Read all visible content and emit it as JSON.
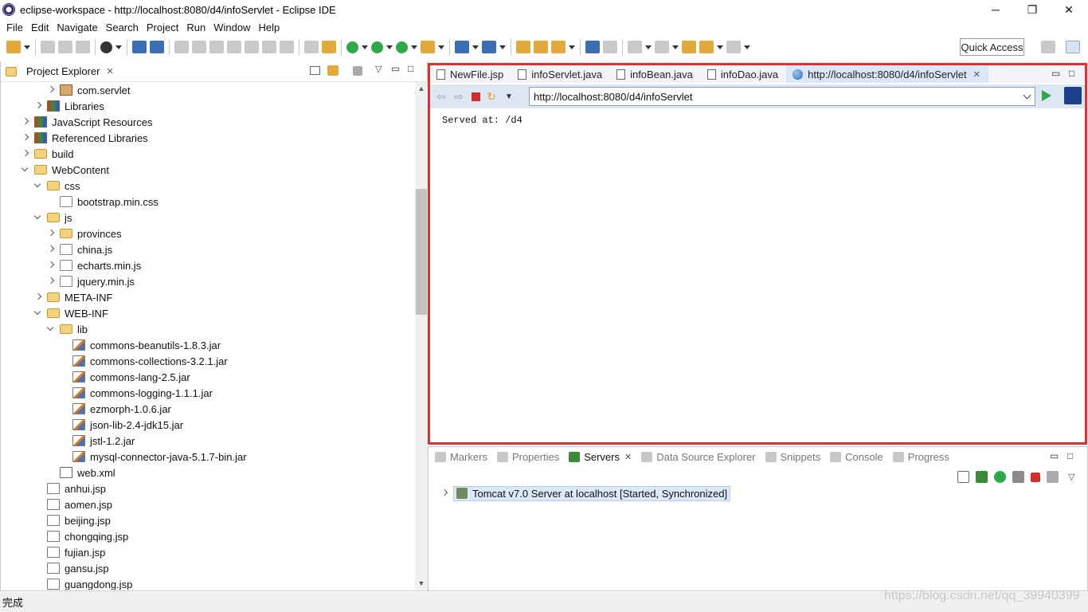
{
  "window": {
    "title": "eclipse-workspace - http://localhost:8080/d4/infoServlet - Eclipse IDE",
    "controls": {
      "minimize": "─",
      "maximize": "❐",
      "close": "✕"
    }
  },
  "menu": [
    "File",
    "Edit",
    "Navigate",
    "Search",
    "Project",
    "Run",
    "Window",
    "Help"
  ],
  "toolbar": {
    "quick_access": "Quick Access"
  },
  "project_explorer": {
    "title": "Project Explorer",
    "close": "✕",
    "items": [
      {
        "label": "com.servlet",
        "icon": "package-icon",
        "indent": 3,
        "twisty": "collapsed"
      },
      {
        "label": "Libraries",
        "icon": "library-icon",
        "indent": 2,
        "twisty": "collapsed"
      },
      {
        "label": "JavaScript Resources",
        "icon": "library-icon",
        "indent": 1,
        "twisty": "collapsed"
      },
      {
        "label": "Referenced Libraries",
        "icon": "library-icon",
        "indent": 1,
        "twisty": "collapsed"
      },
      {
        "label": "build",
        "icon": "folder-icon",
        "indent": 1,
        "twisty": "collapsed"
      },
      {
        "label": "WebContent",
        "icon": "folder-icon",
        "indent": 1,
        "twisty": "expanded"
      },
      {
        "label": "css",
        "icon": "folder-icon",
        "indent": 2,
        "twisty": "expanded"
      },
      {
        "label": "bootstrap.min.css",
        "icon": "css-file-icon",
        "indent": 3,
        "twisty": "none"
      },
      {
        "label": "js",
        "icon": "folder-icon",
        "indent": 2,
        "twisty": "expanded"
      },
      {
        "label": "provinces",
        "icon": "folder-icon",
        "indent": 3,
        "twisty": "collapsed"
      },
      {
        "label": "china.js",
        "icon": "js-file-icon",
        "indent": 3,
        "twisty": "collapsed"
      },
      {
        "label": "echarts.min.js",
        "icon": "js-file-icon",
        "indent": 3,
        "twisty": "collapsed"
      },
      {
        "label": "jquery.min.js",
        "icon": "js-file-icon",
        "indent": 3,
        "twisty": "collapsed"
      },
      {
        "label": "META-INF",
        "icon": "folder-icon",
        "indent": 2,
        "twisty": "collapsed"
      },
      {
        "label": "WEB-INF",
        "icon": "folder-icon",
        "indent": 2,
        "twisty": "expanded"
      },
      {
        "label": "lib",
        "icon": "folder-icon",
        "indent": 3,
        "twisty": "expanded"
      },
      {
        "label": "commons-beanutils-1.8.3.jar",
        "icon": "jar-icon",
        "indent": 4,
        "twisty": "none"
      },
      {
        "label": "commons-collections-3.2.1.jar",
        "icon": "jar-icon",
        "indent": 4,
        "twisty": "none"
      },
      {
        "label": "commons-lang-2.5.jar",
        "icon": "jar-icon",
        "indent": 4,
        "twisty": "none"
      },
      {
        "label": "commons-logging-1.1.1.jar",
        "icon": "jar-icon",
        "indent": 4,
        "twisty": "none"
      },
      {
        "label": "ezmorph-1.0.6.jar",
        "icon": "jar-icon",
        "indent": 4,
        "twisty": "none"
      },
      {
        "label": "json-lib-2.4-jdk15.jar",
        "icon": "jar-icon",
        "indent": 4,
        "twisty": "none"
      },
      {
        "label": "jstl-1.2.jar",
        "icon": "jar-icon",
        "indent": 4,
        "twisty": "none"
      },
      {
        "label": "mysql-connector-java-5.1.7-bin.jar",
        "icon": "jar-icon",
        "indent": 4,
        "twisty": "none"
      },
      {
        "label": "web.xml",
        "icon": "xml-file-icon",
        "indent": 3,
        "twisty": "none"
      },
      {
        "label": "anhui.jsp",
        "icon": "jsp-file-icon",
        "indent": 2,
        "twisty": "none"
      },
      {
        "label": "aomen.jsp",
        "icon": "jsp-file-icon",
        "indent": 2,
        "twisty": "none"
      },
      {
        "label": "beijing.jsp",
        "icon": "jsp-file-icon",
        "indent": 2,
        "twisty": "none"
      },
      {
        "label": "chongqing.jsp",
        "icon": "jsp-file-icon",
        "indent": 2,
        "twisty": "none"
      },
      {
        "label": "fujian.jsp",
        "icon": "jsp-file-icon",
        "indent": 2,
        "twisty": "none"
      },
      {
        "label": "gansu.jsp",
        "icon": "jsp-file-icon",
        "indent": 2,
        "twisty": "none"
      },
      {
        "label": "guangdong.jsp",
        "icon": "jsp-file-icon",
        "indent": 2,
        "twisty": "none"
      }
    ]
  },
  "editor": {
    "tabs": [
      {
        "label": "NewFile.jsp",
        "icon": "jsp-file-icon",
        "active": false
      },
      {
        "label": "infoServlet.java",
        "icon": "java-file-icon",
        "active": false
      },
      {
        "label": "infoBean.java",
        "icon": "java-file-icon",
        "active": false
      },
      {
        "label": "infoDao.java",
        "icon": "java-file-icon",
        "active": false
      },
      {
        "label": "http://localhost:8080/d4/infoServlet",
        "icon": "globe-icon",
        "active": true
      }
    ],
    "close_glyph": "✕",
    "url": "http://localhost:8080/d4/infoServlet",
    "content": "Served at: /d4",
    "highlight_color": "#e03131"
  },
  "bottom_panel": {
    "tabs": [
      {
        "label": "Markers",
        "active": false
      },
      {
        "label": "Properties",
        "active": false
      },
      {
        "label": "Servers",
        "active": true
      },
      {
        "label": "Data Source Explorer",
        "active": false
      },
      {
        "label": "Snippets",
        "active": false
      },
      {
        "label": "Console",
        "active": false
      },
      {
        "label": "Progress",
        "active": false
      }
    ],
    "server": "Tomcat v7.0 Server at localhost  [Started, Synchronized]"
  },
  "status": {
    "text": "完成",
    "watermark": "https://blog.csdn.net/qq_39940399"
  }
}
